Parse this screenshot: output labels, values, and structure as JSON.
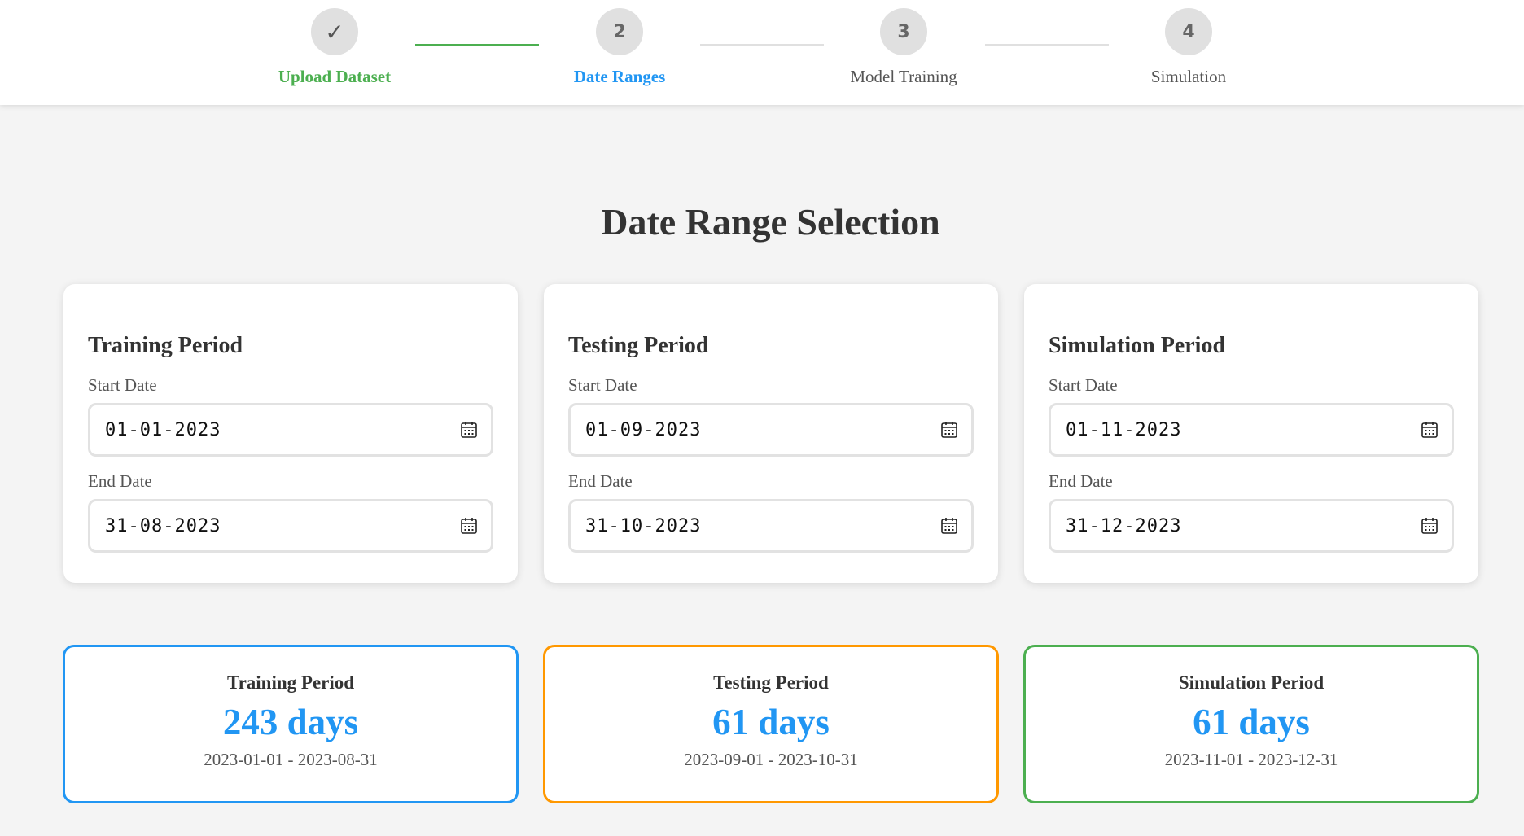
{
  "stepper": {
    "steps": [
      {
        "number": "✓",
        "label": "Upload Dataset",
        "state": "completed"
      },
      {
        "number": "2",
        "label": "Date Ranges",
        "state": "active"
      },
      {
        "number": "3",
        "label": "Model Training",
        "state": "pending"
      },
      {
        "number": "4",
        "label": "Simulation",
        "state": "pending"
      }
    ]
  },
  "page": {
    "title": "Date Range Selection"
  },
  "periods": [
    {
      "title": "Training Period",
      "start_label": "Start Date",
      "start_value": "01-01-2023",
      "end_label": "End Date",
      "end_value": "31-08-2023"
    },
    {
      "title": "Testing Period",
      "start_label": "Start Date",
      "start_value": "01-09-2023",
      "end_label": "End Date",
      "end_value": "31-10-2023"
    },
    {
      "title": "Simulation Period",
      "start_label": "Start Date",
      "start_value": "01-11-2023",
      "end_label": "End Date",
      "end_value": "31-12-2023"
    }
  ],
  "summaries": [
    {
      "title": "Training Period",
      "days": "243 days",
      "range": "2023-01-01 - 2023-08-31",
      "border_color": "#2196f3"
    },
    {
      "title": "Testing Period",
      "days": "61 days",
      "range": "2023-09-01 - 2023-10-31",
      "border_color": "#ff9800"
    },
    {
      "title": "Simulation Period",
      "days": "61 days",
      "range": "2023-11-01 - 2023-12-31",
      "border_color": "#4caf50"
    }
  ],
  "colors": {
    "completed": "#4caf50",
    "active": "#2196f3",
    "days_text": "#2196f3"
  },
  "icons": {
    "date_picker": "calendar-icon"
  }
}
